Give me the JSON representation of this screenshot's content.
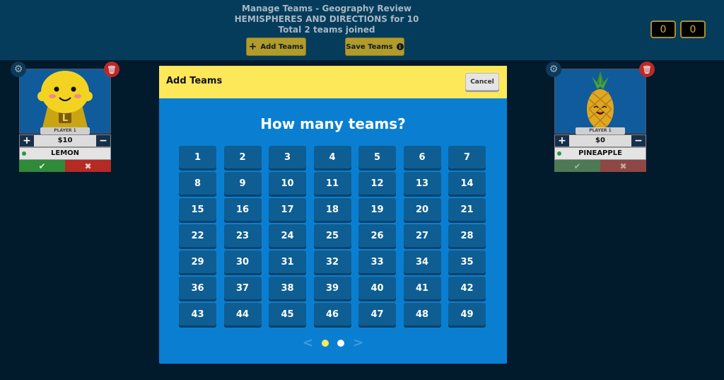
{
  "header": {
    "title_line1": "Manage Teams - Geography Review",
    "title_line2": "HEMISPHERES AND DIRECTIONS for 10",
    "title_line3": "Total 2 teams joined",
    "add_teams_label": "Add Teams",
    "save_teams_label": "Save Teams",
    "scores": [
      "0",
      "0"
    ]
  },
  "teams": [
    {
      "player_label": "PLAYER 1",
      "money": "$10",
      "name": "LEMON",
      "avatar_letter": "L",
      "avatar": "lemon-icon"
    },
    {
      "player_label": "PLAYER 1",
      "money": "$0",
      "name": "PINEAPPLE",
      "avatar": "pineapple-icon"
    }
  ],
  "card_controls": {
    "plus": "+",
    "minus": "−",
    "check": "✔",
    "cross": "✖"
  },
  "modal": {
    "title": "Add Teams",
    "cancel_label": "Cancel",
    "question": "How many teams?",
    "numbers": [
      "1",
      "2",
      "3",
      "4",
      "5",
      "6",
      "7",
      "8",
      "9",
      "10",
      "11",
      "12",
      "13",
      "14",
      "15",
      "16",
      "17",
      "18",
      "19",
      "20",
      "21",
      "22",
      "23",
      "24",
      "25",
      "26",
      "27",
      "28",
      "29",
      "30",
      "31",
      "32",
      "33",
      "34",
      "35",
      "36",
      "37",
      "38",
      "39",
      "40",
      "41",
      "42",
      "43",
      "44",
      "45",
      "46",
      "47",
      "48",
      "49"
    ],
    "pager": {
      "prev": "<",
      "next": ">",
      "pages": 2,
      "current": 1
    }
  },
  "colors": {
    "header_bg": "#053c5c",
    "modal_bg": "#0a7fd1",
    "modal_header": "#fde85a",
    "button_gold": "#b19b2a",
    "number_button": "#0e5e93"
  }
}
